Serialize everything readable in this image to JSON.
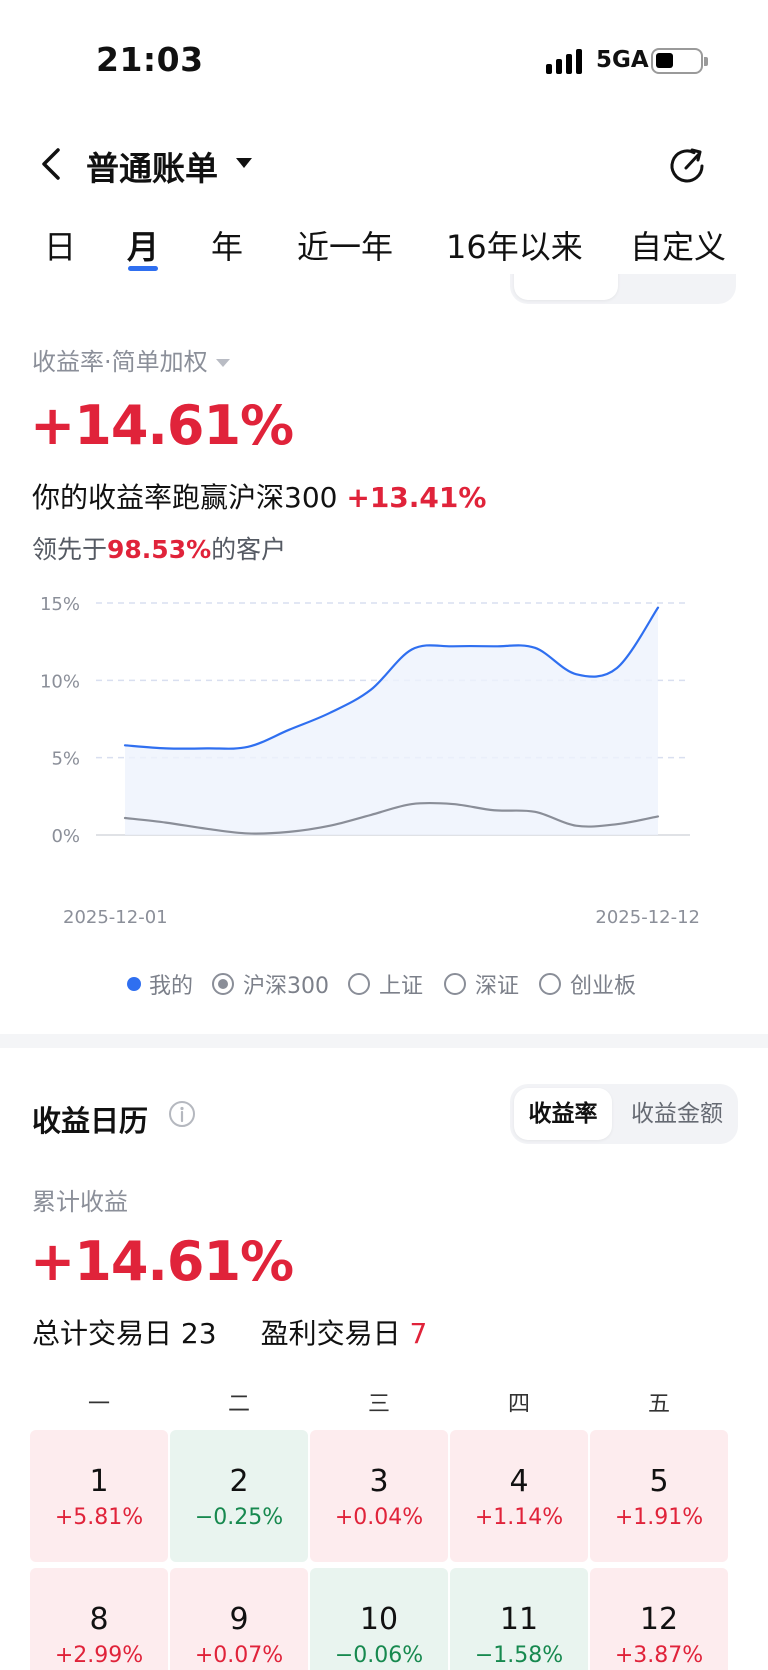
{
  "status_bar": {
    "time": "21:03",
    "network": "5GA"
  },
  "nav": {
    "title": "普通账单"
  },
  "tabs": [
    {
      "label": "日"
    },
    {
      "label": "月"
    },
    {
      "label": "年"
    },
    {
      "label": "近一年"
    },
    {
      "label": "16年以来"
    },
    {
      "label": "自定义"
    }
  ],
  "trend": {
    "metric_label": "收益率·简单加权",
    "rate": "+14.61%",
    "beat_text": "你的收益率跑赢沪深300",
    "beat_value": "+13.41%",
    "lead_prefix": "领先于",
    "lead_value": "98.53%",
    "lead_suffix": "的客户"
  },
  "chart_data": {
    "type": "area",
    "x": [
      "2025-12-01",
      "2025-12-12"
    ],
    "x_tick_labels": [
      "2025-12-01",
      "2025-12-12"
    ],
    "y_tick_labels": [
      "15%",
      "10%",
      "5%",
      "0%"
    ],
    "ylim": [
      0,
      15
    ],
    "grid": true,
    "series": [
      {
        "name": "我的",
        "color": "#2f6ff0",
        "values": [
          5.8,
          5.6,
          5.6,
          5.7,
          6.8,
          7.9,
          9.4,
          12.0,
          12.2,
          12.2,
          12.1,
          10.4,
          10.8,
          14.7
        ]
      },
      {
        "name": "沪深300",
        "color": "#8a8e98",
        "values": [
          1.1,
          0.8,
          0.4,
          0.1,
          0.2,
          0.6,
          1.3,
          2.0,
          2.0,
          1.6,
          1.5,
          0.6,
          0.7,
          1.2
        ]
      }
    ],
    "legend": [
      {
        "label": "我的",
        "style": "dot"
      },
      {
        "label": "沪深300",
        "style": "radio-checked"
      },
      {
        "label": "上证",
        "style": "radio"
      },
      {
        "label": "深证",
        "style": "radio"
      },
      {
        "label": "创业板",
        "style": "radio"
      }
    ]
  },
  "calendar": {
    "title": "收益日历",
    "toggle_active": "收益率",
    "toggle_inactive": "收益金额",
    "cumulative_label": "累计收益",
    "cumulative_value": "+14.61%",
    "total_days_label": "总计交易日",
    "total_days": "23",
    "profit_days_label": "盈利交易日",
    "profit_days": "7",
    "weekdays": [
      "一",
      "二",
      "三",
      "四",
      "五"
    ],
    "days": [
      {
        "day": "1",
        "value": "+5.81%",
        "trend": "up"
      },
      {
        "day": "2",
        "value": "−0.25%",
        "trend": "down"
      },
      {
        "day": "3",
        "value": "+0.04%",
        "trend": "up"
      },
      {
        "day": "4",
        "value": "+1.14%",
        "trend": "up"
      },
      {
        "day": "5",
        "value": "+1.91%",
        "trend": "up"
      },
      {
        "day": "8",
        "value": "+2.99%",
        "trend": "up"
      },
      {
        "day": "9",
        "value": "+0.07%",
        "trend": "up"
      },
      {
        "day": "10",
        "value": "−0.06%",
        "trend": "down"
      },
      {
        "day": "11",
        "value": "−1.58%",
        "trend": "down"
      },
      {
        "day": "12",
        "value": "+3.87%",
        "trend": "up"
      }
    ]
  },
  "colors": {
    "accent": "#2f6ff0",
    "up": "#e0233a",
    "down": "#17894f"
  }
}
